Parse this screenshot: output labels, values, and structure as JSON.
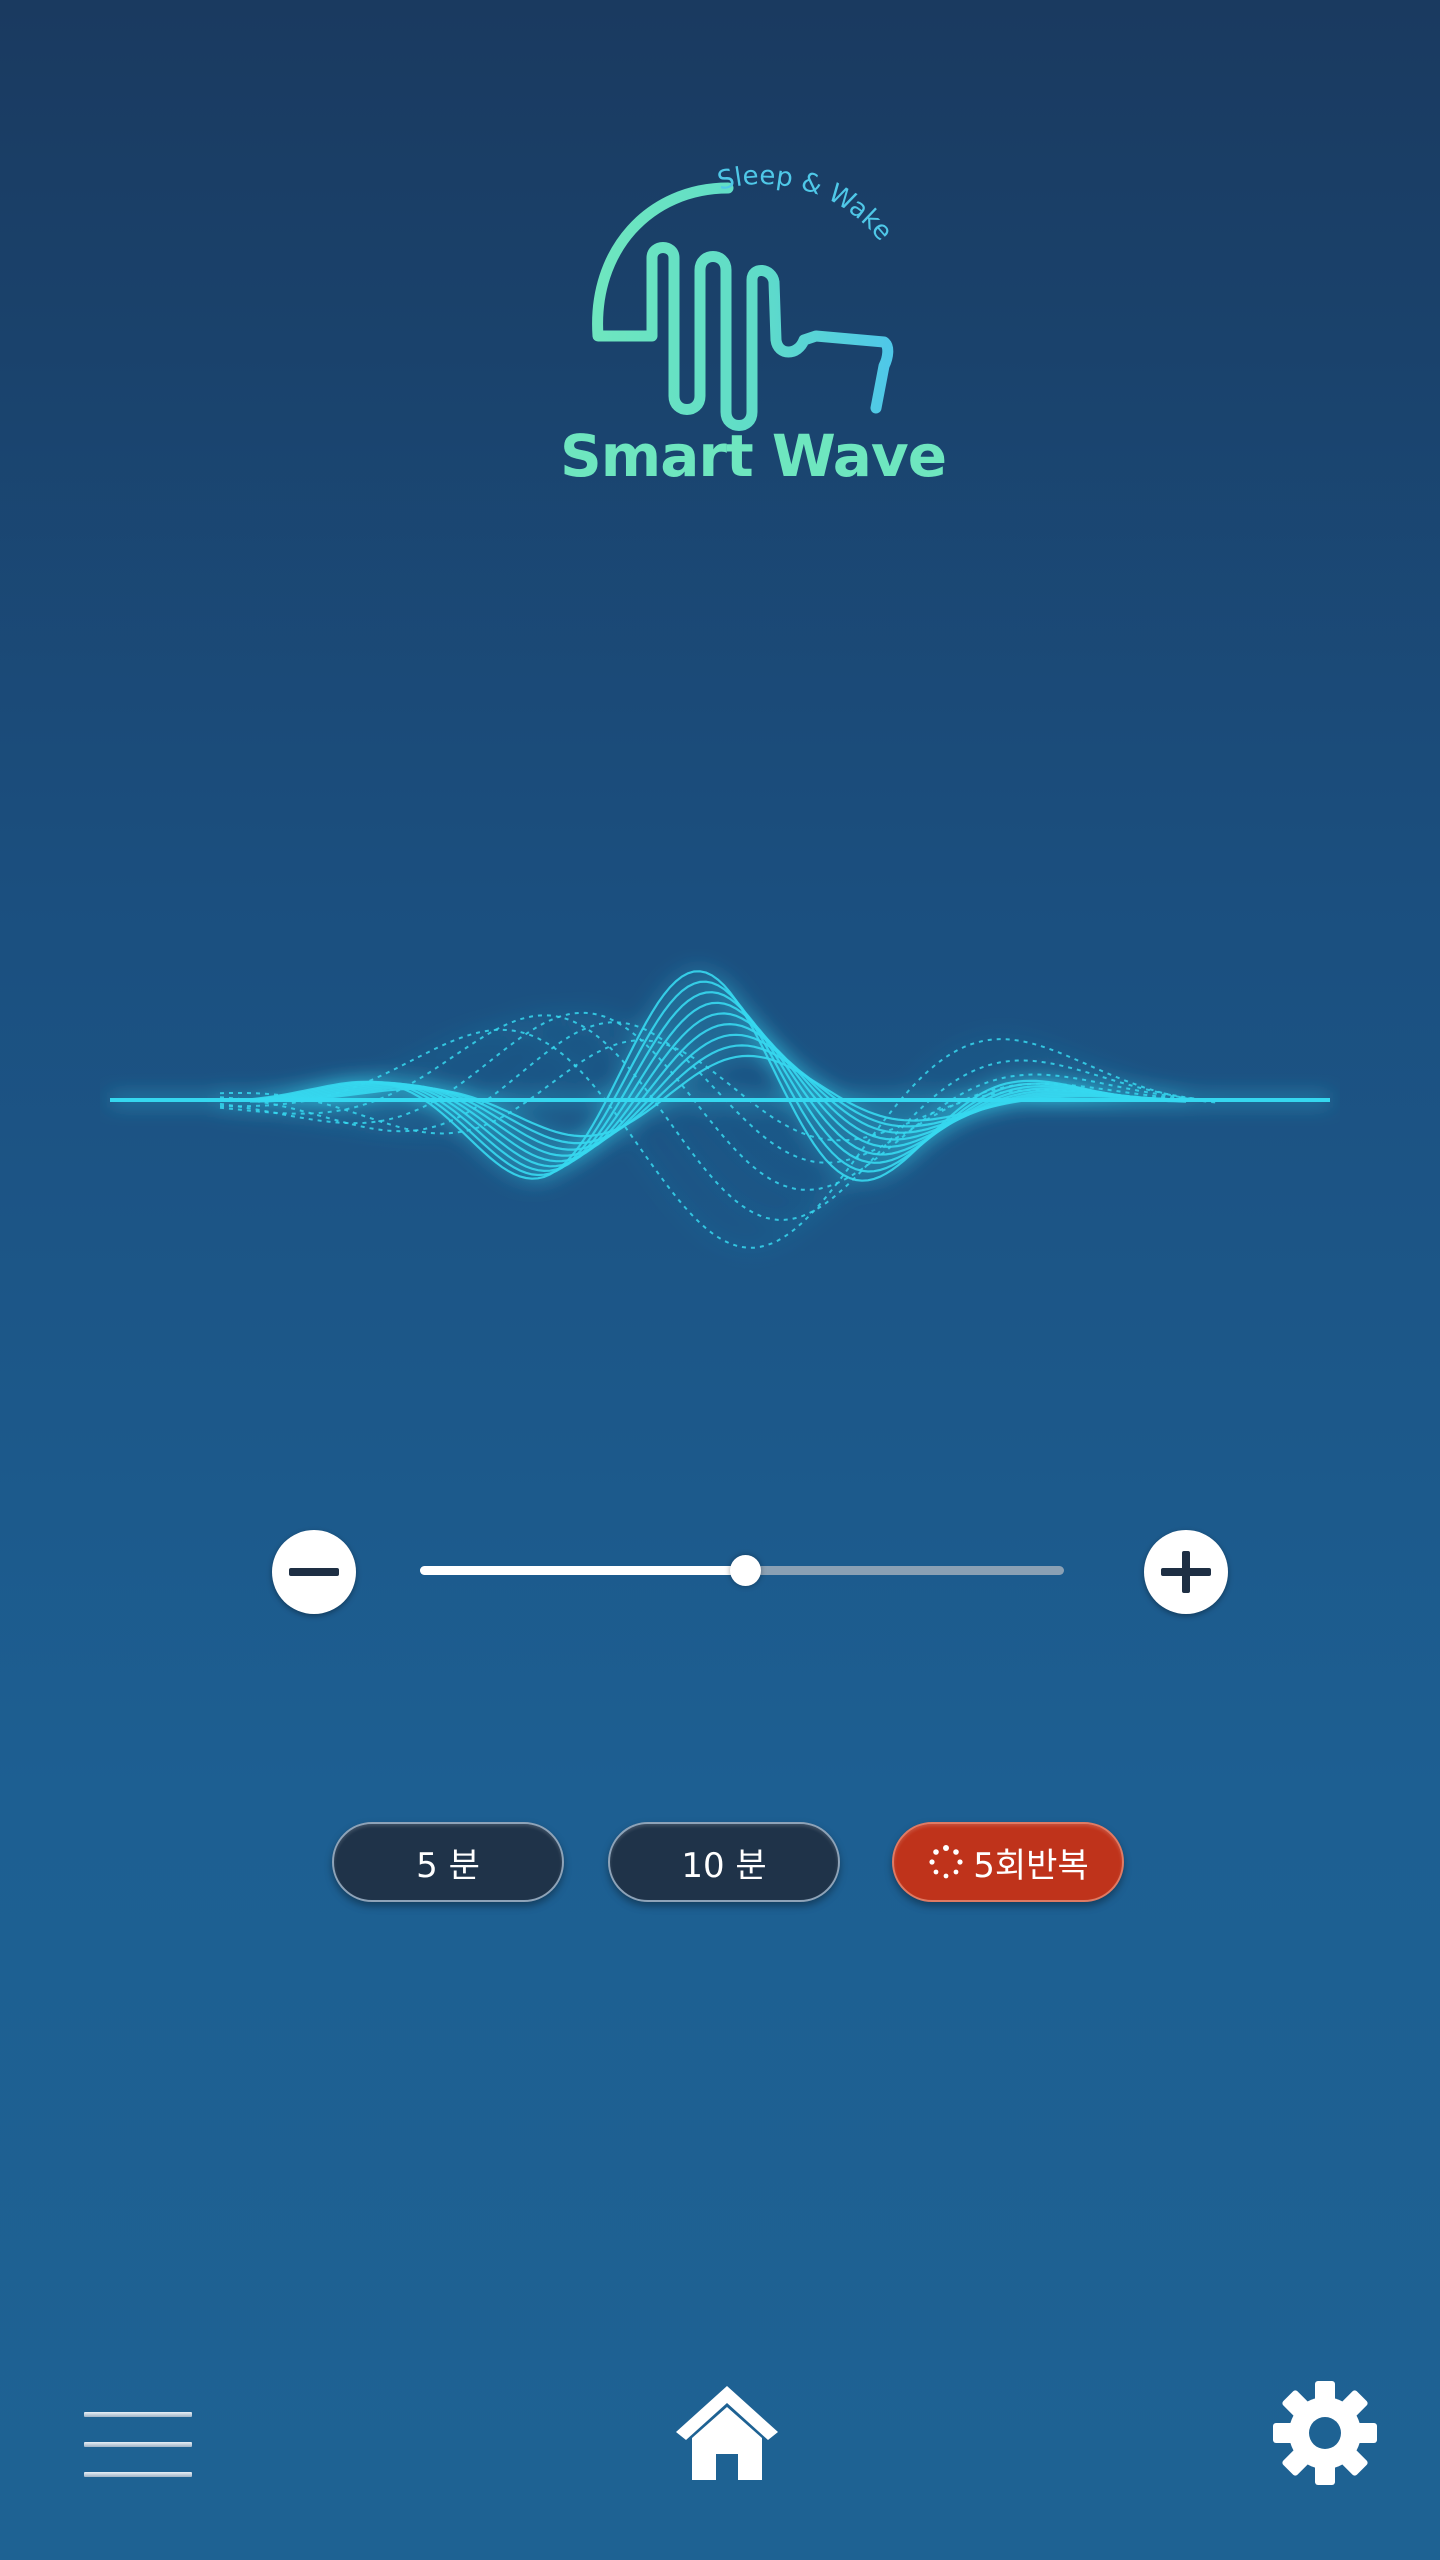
{
  "app": {
    "logo_title": "Smart Wave",
    "logo_tagline": "Sleep & Wake",
    "logo_icon": "wave-icon"
  },
  "colors": {
    "background_top": "#1a3a60",
    "background_bottom": "#1e6293",
    "logo_green": "#6ee6bf",
    "logo_cyan": "#4fd0e8",
    "wave_cyan": "#36d8f0",
    "pill_dark": "#1f3349",
    "pill_active": "#bf331b"
  },
  "volume": {
    "level": 0.505,
    "decrease_icon": "minus-icon",
    "increase_icon": "plus-icon"
  },
  "timer_options": [
    {
      "label": "5 분",
      "active": false
    },
    {
      "label": "10 분",
      "active": false
    },
    {
      "label": "5회반복",
      "active": true,
      "icon": "spinner-icon"
    }
  ],
  "nav": {
    "menu_icon": "menu-icon",
    "home_icon": "home-icon",
    "settings_icon": "gear-icon"
  }
}
